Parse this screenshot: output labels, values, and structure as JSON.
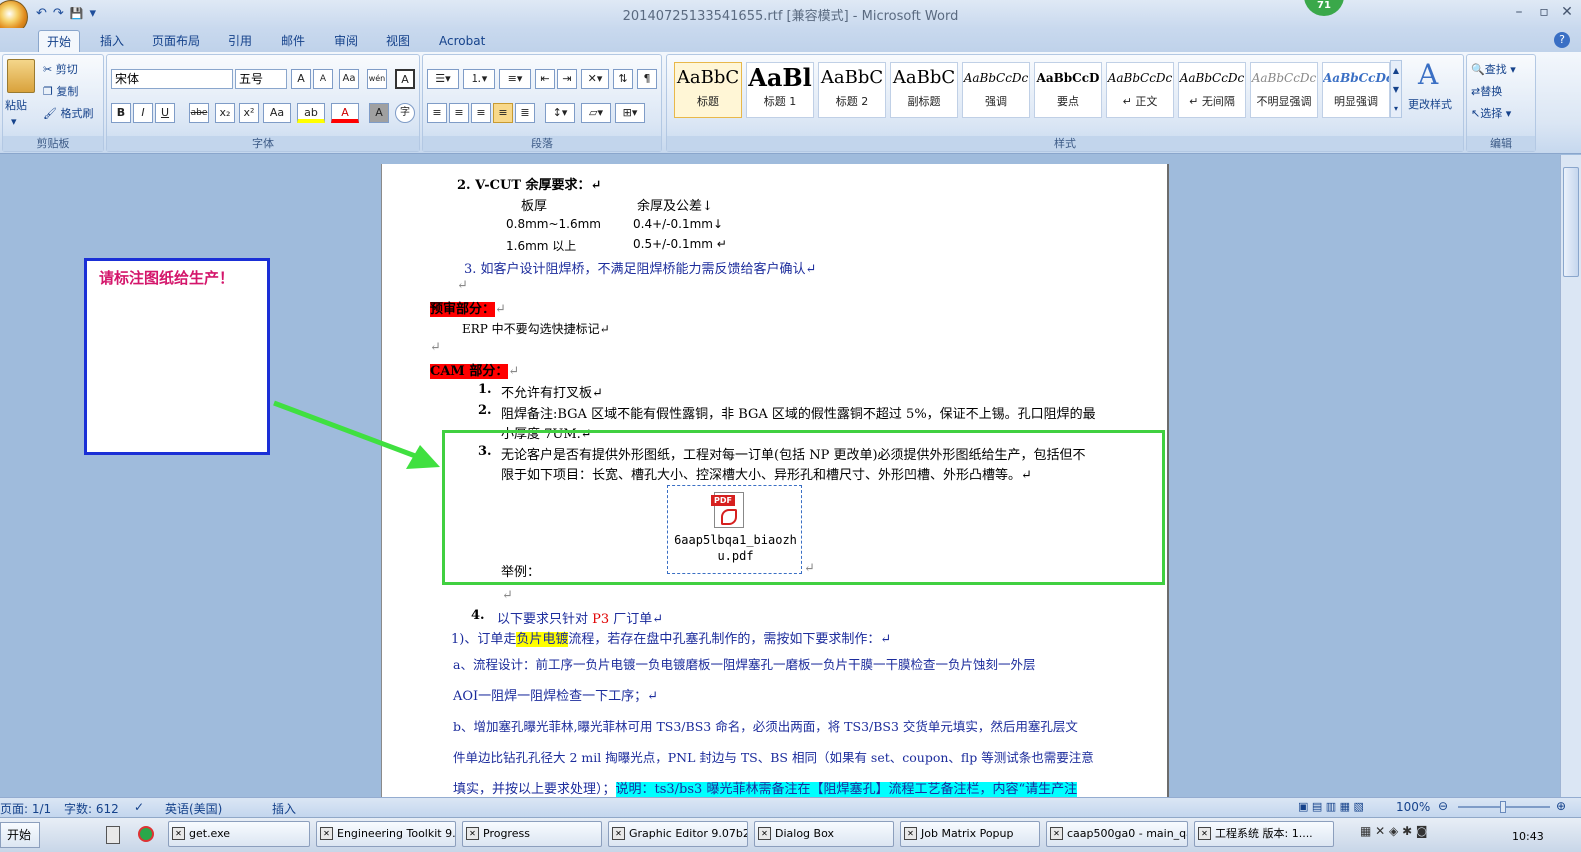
{
  "window": {
    "title": "20140725133541655.rtf [兼容模式] - Microsoft Word",
    "notif_count": "71"
  },
  "qat": {
    "undo": "↶",
    "redo": "↷",
    "save": "💾",
    "more": "▾"
  },
  "tabs": [
    "开始",
    "插入",
    "页面布局",
    "引用",
    "邮件",
    "审阅",
    "视图",
    "Acrobat"
  ],
  "clipboard": {
    "paste": "粘贴",
    "cut": "剪切",
    "copy": "复制",
    "format_painter": "格式刷",
    "label": "剪贴板"
  },
  "font": {
    "name": "宋体",
    "size": "五号",
    "label": "字体",
    "bold": "B",
    "italic": "I",
    "underline": "U",
    "strike": "abe",
    "sub": "x₂",
    "sup": "x²",
    "case": "Aa",
    "grow": "A",
    "shrink": "A",
    "clear": "Aa",
    "pinyin": "wén",
    "border": "A",
    "highlight": "ab",
    "color": "A",
    "shade": "A",
    "enclose": "字"
  },
  "paragraph": {
    "label": "段落"
  },
  "styles": {
    "label": "样式",
    "change": "更改样式",
    "items": [
      {
        "sample": "AaBbC",
        "name": "标题"
      },
      {
        "sample": "AaBl",
        "name": "标题 1"
      },
      {
        "sample": "AaBbC",
        "name": "标题 2"
      },
      {
        "sample": "AaBbC",
        "name": "副标题"
      },
      {
        "sample": "AaBbCcDc",
        "name": "强调"
      },
      {
        "sample": "AaBbCcD",
        "name": "要点"
      },
      {
        "sample": "AaBbCcDc",
        "name": "↵ 正文"
      },
      {
        "sample": "AaBbCcDc",
        "name": "↵ 无间隔"
      },
      {
        "sample": "AaBbCcDc",
        "name": "不明显强调"
      },
      {
        "sample": "AaBbCcDc",
        "name": "明显强调"
      }
    ]
  },
  "editing": {
    "find": "查找",
    "replace": "替换",
    "select": "选择",
    "label": "编辑"
  },
  "note": {
    "text": "请标注图纸给生产！"
  },
  "doc": {
    "l1": "2. V-CUT 余厚要求：↵",
    "th1": "板厚",
    "th2": "余厚及公差↓",
    "r1a": "0.8mm~1.6mm",
    "r1b": "0.4+/-0.1mm↓",
    "r2a": "1.6mm 以上",
    "r2b": "0.5+/-0.1mm ↵",
    "l3": "3.   如客户设计阻焊桥，不满足阻焊桥能力需反馈给客户确认↵",
    "para1": "↵",
    "pre": "预审部分：",
    "pre_tail": "↵",
    "erp": "ERP 中不要勾选快捷标记↵",
    "para2": "↵",
    "cam": "CAM 部分：",
    "cam_tail": "↵",
    "n1": "1.",
    "c1": "不允许有打叉板↵",
    "n2": "2.",
    "c2a": "阻焊备注:BGA 区域不能有假性露铜，非 BGA 区域的假性露铜不超过 5%，保证不上锡。孔口阻焊的最",
    "c2b": "小厚度 7UM.↵",
    "n3": "3.",
    "c3a": "无论客户是否有提供外形图纸，工程对每一订单(包括 NP 更改单)必须提供外形图纸给生产，包括但不",
    "c3b": "限于如下项目：长宽、槽孔大小、控深槽大小、异形孔和槽尺寸、外形凹槽、外形凸槽等。↵",
    "example": "举例：",
    "pdf_badge": "PDF",
    "pdf_name1": "6aap5lbqa1_biaozh",
    "pdf_name2": "u.pdf",
    "pdf_tail": "↵",
    "para3": "↵",
    "n4": "4.",
    "c4a": "以下要求只针对 ",
    "c4b": "P3",
    "c4c": " 厂订单↵",
    "s1a": "1)、订单走",
    "s1b": "负片电镀",
    "s1c": "流程，若存在盘中孔塞孔制作的，需按如下要求制作：↵",
    "s2a": "a、流程设计：前工序一负片电镀一负电镀磨板一阻焊塞孔一磨板一负片干膜一干膜检查一负片蚀刻一外层",
    "s2b": "AOI一阻焊一阻焊检查一下工序；↵",
    "s3a": "b、增加塞孔曝光菲林,曝光菲林可用 TS3/BS3 命名，必须出两面，将 TS3/BS3 交货单元填实，然后用塞孔层文",
    "s3b": "件单边比钻孔孔径大 2 mil 掏曝光点，PNL 封边与 TS、BS 相同（如果有 set、coupon、flp 等测试条也需要注意",
    "s4a": "填实，并按以上要求处理）；",
    "s4b": "说明：ts3/bs3 曝光菲林需备注在【阻焊塞孔】流程工艺备注栏，内容“请生产注"
  },
  "status": {
    "page": "页面: 1/1",
    "words": "字数: 612",
    "lang": "英语(美国)",
    "mode": "插入",
    "zoom": "100%"
  },
  "taskbar": {
    "start": "开始",
    "tasks": [
      "get.exe",
      "Engineering Toolkit 9....",
      "Progress",
      "Graphic Editor 9.07b2 ...",
      "Dialog Box",
      "Job Matrix Popup",
      "caap500ga0 - main_qa",
      "工程系统  版本: 1...."
    ],
    "clock": "10:43"
  },
  "colors": {
    "accent": "#15428b",
    "note_border": "#1a2fd6",
    "note_text": "#d4166b",
    "green": "#40d040",
    "red": "#ff0000",
    "cyan": "#00ffff",
    "yellow": "#ffff00"
  }
}
